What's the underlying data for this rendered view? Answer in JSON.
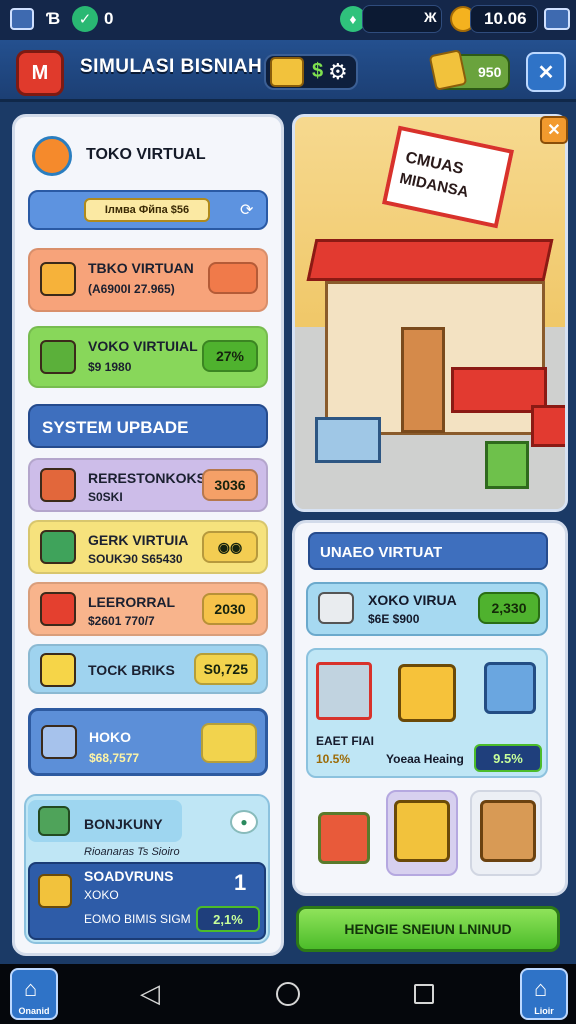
{
  "status": {
    "left_count": "0",
    "right_value": "10.06",
    "right_code": "Ж"
  },
  "header": {
    "logo_letter": "M",
    "title": "SIMULASI BISNIAH",
    "ticket_label": "$",
    "right_chip_value": "950"
  },
  "left": {
    "store_title": "TOKO VIRTUAL",
    "search_chip": "Ілмва Фйпа $56",
    "rows_top": [
      {
        "title": "TBKO VIRTUAN",
        "sub": "(A6900I 27.965)",
        "color": "#f7a37a"
      },
      {
        "title": "VOKO VIRTUIAL",
        "sub": "$9 1980",
        "tag": "27%",
        "color": "#88d75a"
      }
    ],
    "section_title": "SYSTEM UPBADE",
    "upgrades": [
      {
        "title": "RERESTONKOKS",
        "sub": "S0SKI",
        "tag": "3036",
        "color": "#cdbde9",
        "tagcolor": "#f5a067"
      },
      {
        "title": "GERK VIRTUIA",
        "sub": "SOUKЭ0 S65430",
        "color": "#f6e27d",
        "tagcolor": "#f3cd52"
      },
      {
        "title": "LEERORRAL",
        "sub": "$2601 770/7",
        "tag": "2030",
        "color": "#f8b48c",
        "tagcolor": "#f6c24a"
      },
      {
        "title": "TOCK BRIKS",
        "tag": "S0,725",
        "color": "#9fd3ef",
        "tagcolor": "#f2d34d"
      },
      {
        "title": "HOKO",
        "sub": "$68,7577",
        "color": "#5c8fd8",
        "tagcolor": "#f2d34d"
      }
    ],
    "bottom_card": {
      "title": "BONJKUNY",
      "sub": "Rioanaras Ts Sioiro",
      "inner_title": "SOADVRUNS",
      "inner_sub": "XOKO",
      "inner_line": "EOMO BIMIS SIGM",
      "inner_tag": "2,1%",
      "inner_count": "1"
    }
  },
  "scene": {
    "sign_line1": "CMUAS",
    "sign_line2": "MIDANSA"
  },
  "right": {
    "section_title": "UNAEO VIRTUAT",
    "item": {
      "title": "XOKO VIRUA",
      "sub": "$6E $900",
      "tag": "2,330"
    },
    "stat_left_label": "EAET FIAI",
    "stat_left_value": "10.5%",
    "stat_mid_label": "Yoeaa Heaing",
    "stat_right_value": "9.5%"
  },
  "cta": {
    "label": "HENGIE SNEIUN LNINUD"
  },
  "nav": {
    "left_label": "Onanid",
    "right_label": "Lioir"
  },
  "colors": {
    "accent": "#2f73c7",
    "header": "#24508f",
    "cta": "#4cbc2a"
  }
}
